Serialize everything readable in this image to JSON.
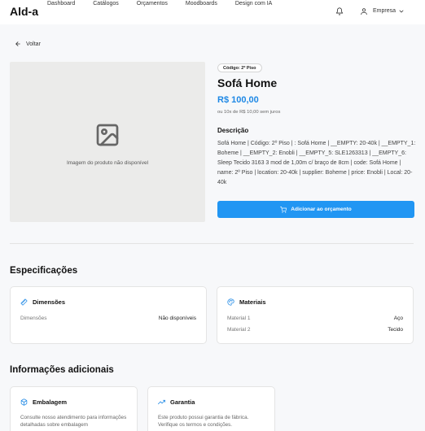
{
  "header": {
    "logo": "Ald-a",
    "nav": [
      "Dashboard",
      "Catálogos",
      "Orçamentos",
      "Moodboards",
      "Design com IA"
    ],
    "company": "Empresa"
  },
  "back_label": "Voltar",
  "image": {
    "caption": "Imagem do produto não disponível"
  },
  "product": {
    "code_badge": "Código: 2º Piso",
    "title": "Sofá Home",
    "price": "R$ 100,00",
    "installments": "ou 10x de R$ 10,00 sem juros",
    "description_heading": "Descrição",
    "description": "Sofá Home | Código: 2º Piso | : Sofá Home | __EMPTY: 20-40k | __EMPTY_1: Boheme | __EMPTY_2: Enobli | __EMPTY_5: SLE1263313 | __EMPTY_6: Sleep Tecido 3163 3 mod de 1,00m c/ braço de 8cm | code: Sofá Home | name: 2º Piso | location: 20-40k | supplier: Boheme | price: Enobli | Local: 20-40k",
    "add_button": "Adicionar ao orçamento"
  },
  "specs": {
    "heading": "Especificações",
    "dimensions": {
      "title": "Dimensões",
      "label": "Dimensões",
      "value": "Não disponíveis"
    },
    "materials": {
      "title": "Materiais",
      "rows": [
        {
          "label": "Material 1",
          "value": "Aço"
        },
        {
          "label": "Material 2",
          "value": "Tecido"
        }
      ]
    }
  },
  "additional": {
    "heading": "Informações adicionais",
    "packaging": {
      "title": "Embalagem",
      "text": "Consulte nosso atendimento para informações detalhadas sobre embalagem"
    },
    "warranty": {
      "title": "Garantia",
      "text": "Este produto possui garantia de fábrica. Verifique os termos e condições."
    }
  },
  "colors": {
    "accent": "#2196f3",
    "price": "#1e88e5",
    "background": "#f7f8fa"
  },
  "icons": [
    "bell-icon",
    "user-icon",
    "chevron-down-icon",
    "arrow-left-icon",
    "image-placeholder-icon",
    "cart-icon",
    "ruler-icon",
    "palette-icon",
    "box-icon",
    "trending-up-icon"
  ]
}
